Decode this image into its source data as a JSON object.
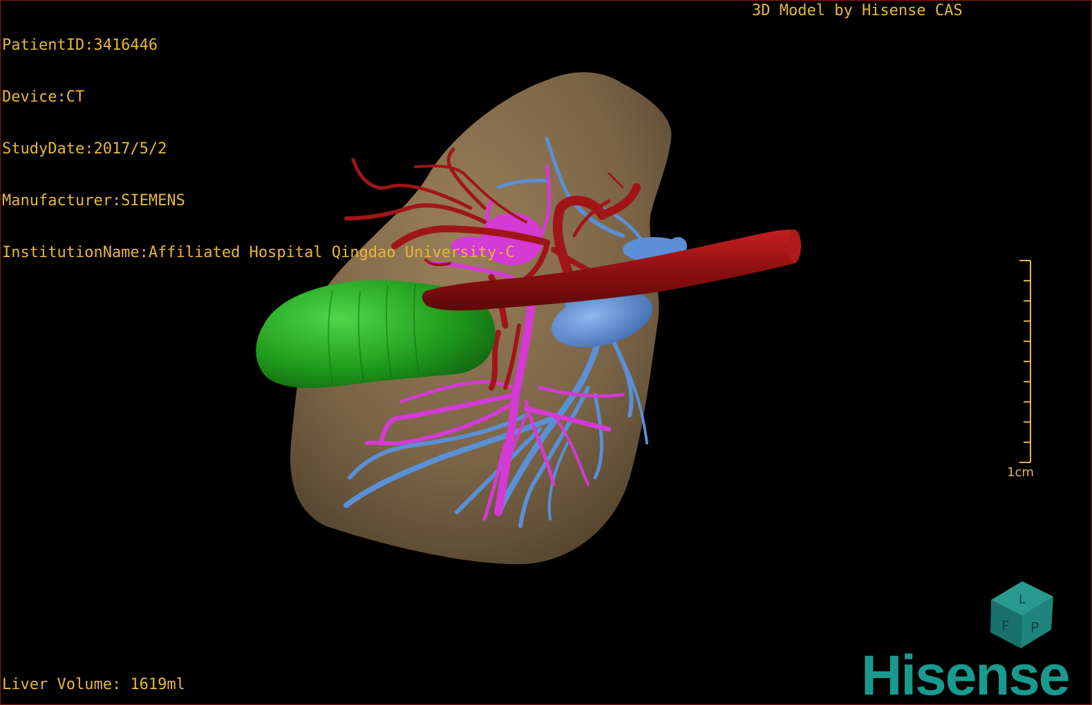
{
  "patient_info": {
    "patient_id": "PatientID:3416446",
    "device": "Device:CT",
    "study_date": "StudyDate:2017/5/2",
    "manufacturer": "Manufacturer:SIEMENS",
    "institution": "InstitutionName:Affiliated Hospital Qingdao University-C"
  },
  "credit": "3D Model by Hisense CAS",
  "liver_volume": "Liver Volume: 1619ml",
  "scale_bar": {
    "label": "1cm",
    "ticks": 10
  },
  "orientation_cube": {
    "icon": "orientation-cube-icon",
    "faces": [
      "F",
      "L",
      "P"
    ]
  },
  "brand": "Hisense",
  "colors": {
    "overlay_text": "#e8b83a",
    "liver": "#7a6446",
    "portal_vein": "#5b8fd6",
    "hepatic_artery": "#a01616",
    "bile_duct": "#d43ad4",
    "gallbladder": "#23a81f",
    "brand": "#1a9a8e"
  }
}
